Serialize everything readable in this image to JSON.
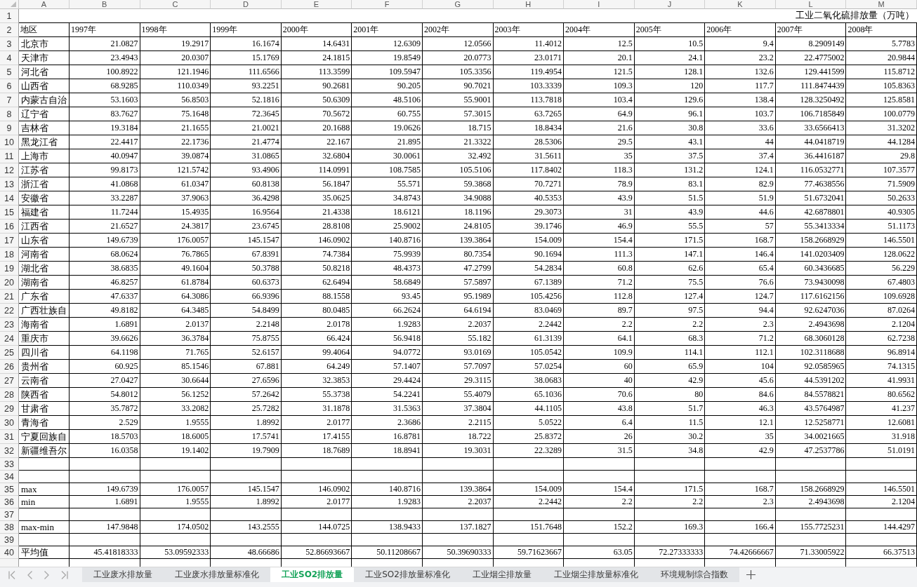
{
  "column_headers": [
    "A",
    "B",
    "C",
    "D",
    "E",
    "F",
    "G",
    "H",
    "I",
    "J",
    "K",
    "L",
    "M"
  ],
  "rows": [
    {
      "number": "1",
      "kind": "title",
      "title": "工业二氧化硫排放量（万吨）"
    },
    {
      "number": "2",
      "kind": "header",
      "cells": [
        "地区",
        "1997年",
        "1998年",
        "1999年",
        "2000年",
        "2001年",
        "2002年",
        "2003年",
        "2004年",
        "2005年",
        "2006年",
        "2007年",
        "2008年"
      ]
    },
    {
      "number": "3",
      "kind": "data",
      "cells": [
        "北京市",
        "21.0827",
        "19.2917",
        "16.1674",
        "14.6431",
        "12.6309",
        "12.0566",
        "11.4012",
        "12.5",
        "10.5",
        "9.4",
        "8.2909149",
        "5.7783"
      ]
    },
    {
      "number": "4",
      "kind": "data",
      "cells": [
        "天津市",
        "23.4943",
        "20.0307",
        "15.1769",
        "24.1815",
        "19.8549",
        "20.0773",
        "23.0171",
        "20.1",
        "24.1",
        "23.2",
        "22.4775002",
        "20.9844"
      ]
    },
    {
      "number": "5",
      "kind": "data",
      "cells": [
        "河北省",
        "100.8922",
        "121.1946",
        "111.6566",
        "113.3599",
        "109.5947",
        "105.3356",
        "119.4954",
        "121.5",
        "128.1",
        "132.6",
        "129.441599",
        "115.8712"
      ]
    },
    {
      "number": "6",
      "kind": "data",
      "cells": [
        "山西省",
        "68.9285",
        "110.0349",
        "93.2251",
        "90.2681",
        "90.205",
        "90.7021",
        "103.3339",
        "109.3",
        "120",
        "117.7",
        "111.8474439",
        "105.8363"
      ]
    },
    {
      "number": "7",
      "kind": "data",
      "cells": [
        "内蒙古自治",
        "53.1603",
        "56.8503",
        "52.1816",
        "50.6309",
        "48.5106",
        "55.9001",
        "113.7818",
        "103.4",
        "129.6",
        "138.4",
        "128.3250492",
        "125.8581"
      ]
    },
    {
      "number": "8",
      "kind": "data",
      "cells": [
        "辽宁省",
        "83.7627",
        "75.1648",
        "72.3645",
        "70.5672",
        "60.755",
        "57.3015",
        "63.7265",
        "64.9",
        "96.1",
        "103.7",
        "106.7185849",
        "100.0779"
      ]
    },
    {
      "number": "9",
      "kind": "data",
      "cells": [
        "吉林省",
        "19.3184",
        "21.1655",
        "21.0021",
        "20.1688",
        "19.0626",
        "18.715",
        "18.8434",
        "21.6",
        "30.8",
        "33.6",
        "33.6566413",
        "31.3202"
      ]
    },
    {
      "number": "10",
      "kind": "data",
      "cells": [
        "黑龙江省",
        "22.4417",
        "22.1736",
        "21.4774",
        "22.167",
        "21.895",
        "21.3322",
        "28.5306",
        "29.5",
        "43.1",
        "44",
        "44.0418719",
        "44.1284"
      ]
    },
    {
      "number": "11",
      "kind": "data",
      "cells": [
        "上海市",
        "40.0947",
        "39.0874",
        "31.0865",
        "32.6804",
        "30.0061",
        "32.492",
        "31.5611",
        "35",
        "37.5",
        "37.4",
        "36.4416187",
        "29.8"
      ]
    },
    {
      "number": "12",
      "kind": "data",
      "cells": [
        "江苏省",
        "99.8173",
        "121.5742",
        "93.4906",
        "114.0991",
        "108.7585",
        "105.5106",
        "117.8402",
        "118.3",
        "131.2",
        "124.1",
        "116.0532771",
        "107.3577"
      ]
    },
    {
      "number": "13",
      "kind": "data",
      "cells": [
        "浙江省",
        "41.0868",
        "61.0347",
        "60.8138",
        "56.1847",
        "55.571",
        "59.3868",
        "70.7271",
        "78.9",
        "83.1",
        "82.9",
        "77.4638556",
        "71.5909"
      ]
    },
    {
      "number": "14",
      "kind": "data",
      "cells": [
        "安徽省",
        "33.2287",
        "37.9063",
        "36.4298",
        "35.0625",
        "34.8743",
        "34.9088",
        "40.5353",
        "43.9",
        "51.5",
        "51.9",
        "51.6732041",
        "50.2633"
      ]
    },
    {
      "number": "15",
      "kind": "data",
      "cells": [
        "福建省",
        "11.7244",
        "15.4935",
        "16.9564",
        "21.4338",
        "18.6121",
        "18.1196",
        "29.3073",
        "31",
        "43.9",
        "44.6",
        "42.6878801",
        "40.9305"
      ]
    },
    {
      "number": "16",
      "kind": "data",
      "cells": [
        "江西省",
        "21.6527",
        "24.3817",
        "23.6745",
        "28.8108",
        "25.9002",
        "24.8105",
        "39.1746",
        "46.9",
        "55.5",
        "57",
        "55.3413334",
        "51.1173"
      ]
    },
    {
      "number": "17",
      "kind": "data",
      "cells": [
        "山东省",
        "149.6739",
        "176.0057",
        "145.1547",
        "146.0902",
        "140.8716",
        "139.3864",
        "154.009",
        "154.4",
        "171.5",
        "168.7",
        "158.2668929",
        "146.5501"
      ]
    },
    {
      "number": "18",
      "kind": "data",
      "cells": [
        "河南省",
        "68.0624",
        "76.7865",
        "67.8391",
        "74.7384",
        "75.9939",
        "80.7354",
        "90.1694",
        "111.3",
        "147.1",
        "146.4",
        "141.0203409",
        "128.0622"
      ]
    },
    {
      "number": "19",
      "kind": "data",
      "cells": [
        "湖北省",
        "38.6835",
        "49.1604",
        "50.3788",
        "50.8218",
        "48.4373",
        "47.2799",
        "54.2834",
        "60.8",
        "62.6",
        "65.4",
        "60.3436685",
        "56.229"
      ]
    },
    {
      "number": "20",
      "kind": "data",
      "cells": [
        "湖南省",
        "46.8257",
        "61.8784",
        "60.6373",
        "62.6494",
        "58.6849",
        "57.5897",
        "67.1389",
        "71.2",
        "75.5",
        "76.6",
        "73.9430098",
        "67.4803"
      ]
    },
    {
      "number": "21",
      "kind": "data",
      "cells": [
        "广东省",
        "47.6337",
        "64.3086",
        "66.9396",
        "88.1558",
        "93.45",
        "95.1989",
        "105.4256",
        "112.8",
        "127.4",
        "124.7",
        "117.6162156",
        "109.6928"
      ]
    },
    {
      "number": "22",
      "kind": "data",
      "cells": [
        "广西壮族自",
        "49.8182",
        "64.3485",
        "54.8499",
        "80.0485",
        "66.2624",
        "64.6194",
        "83.0469",
        "89.7",
        "97.5",
        "94.4",
        "92.6247036",
        "87.0264"
      ]
    },
    {
      "number": "23",
      "kind": "data",
      "cells": [
        "海南省",
        "1.6891",
        "2.0137",
        "2.2148",
        "2.0178",
        "1.9283",
        "2.2037",
        "2.2442",
        "2.2",
        "2.2",
        "2.3",
        "2.4943698",
        "2.1204"
      ]
    },
    {
      "number": "24",
      "kind": "data",
      "cells": [
        "重庆市",
        "39.6626",
        "36.3784",
        "75.8755",
        "66.424",
        "56.9418",
        "55.182",
        "61.3139",
        "64.1",
        "68.3",
        "71.2",
        "68.3060128",
        "62.7238"
      ]
    },
    {
      "number": "25",
      "kind": "data",
      "cells": [
        "四川省",
        "64.1198",
        "71.765",
        "52.6157",
        "99.4064",
        "94.0772",
        "93.0169",
        "105.0542",
        "109.9",
        "114.1",
        "112.1",
        "102.3118688",
        "96.8914"
      ]
    },
    {
      "number": "26",
      "kind": "data",
      "cells": [
        "贵州省",
        "60.925",
        "85.1546",
        "67.881",
        "64.249",
        "57.1407",
        "57.7097",
        "57.0254",
        "60",
        "65.9",
        "104",
        "92.0585965",
        "74.1315"
      ]
    },
    {
      "number": "27",
      "kind": "data",
      "cells": [
        "云南省",
        "27.0427",
        "30.6644",
        "27.6596",
        "32.3853",
        "29.4424",
        "29.3115",
        "38.0683",
        "40",
        "42.9",
        "45.6",
        "44.5391202",
        "41.9931"
      ]
    },
    {
      "number": "28",
      "kind": "data",
      "cells": [
        "陕西省",
        "54.8012",
        "56.1252",
        "57.2642",
        "55.3738",
        "54.2241",
        "55.4079",
        "65.1036",
        "70.6",
        "80",
        "84.6",
        "84.5578821",
        "80.6562"
      ]
    },
    {
      "number": "29",
      "kind": "data",
      "cells": [
        "甘肃省",
        "35.7872",
        "33.2082",
        "25.7282",
        "31.1878",
        "31.5363",
        "37.3804",
        "44.1105",
        "43.8",
        "51.7",
        "46.3",
        "43.5764987",
        "41.237"
      ]
    },
    {
      "number": "30",
      "kind": "data",
      "cells": [
        "青海省",
        "2.529",
        "1.9555",
        "1.8992",
        "2.0177",
        "2.3686",
        "2.2115",
        "5.0522",
        "6.4",
        "11.5",
        "12.1",
        "12.5258771",
        "12.6081"
      ]
    },
    {
      "number": "31",
      "kind": "data",
      "cells": [
        "宁夏回族自",
        "18.5703",
        "18.6005",
        "17.5741",
        "17.4155",
        "16.8781",
        "18.722",
        "25.8372",
        "26",
        "30.2",
        "35",
        "34.0021665",
        "31.918"
      ]
    },
    {
      "number": "32",
      "kind": "data",
      "cells": [
        "新疆维吾尔",
        "16.0358",
        "19.1402",
        "19.7909",
        "18.7689",
        "18.8941",
        "19.3031",
        "22.3289",
        "31.5",
        "34.8",
        "42.9",
        "47.2537786",
        "51.0191"
      ]
    },
    {
      "number": "33",
      "kind": "blank"
    },
    {
      "number": "34",
      "kind": "blank"
    },
    {
      "number": "35",
      "kind": "data",
      "cells": [
        "max",
        "149.6739",
        "176.0057",
        "145.1547",
        "146.0902",
        "140.8716",
        "139.3864",
        "154.009",
        "154.4",
        "171.5",
        "168.7",
        "158.2668929",
        "146.5501"
      ]
    },
    {
      "number": "36",
      "kind": "data",
      "cells": [
        "min",
        "1.6891",
        "1.9555",
        "1.8992",
        "2.0177",
        "1.9283",
        "2.2037",
        "2.2442",
        "2.2",
        "2.2",
        "2.3",
        "2.4943698",
        "2.1204"
      ]
    },
    {
      "number": "37",
      "kind": "blank"
    },
    {
      "number": "38",
      "kind": "data",
      "cells": [
        "max-min",
        "147.9848",
        "174.0502",
        "143.2555",
        "144.0725",
        "138.9433",
        "137.1827",
        "151.7648",
        "152.2",
        "169.3",
        "166.4",
        "155.7725231",
        "144.4297"
      ]
    },
    {
      "number": "39",
      "kind": "blank"
    },
    {
      "number": "40",
      "kind": "data",
      "cells": [
        "平均值",
        "45.41818333",
        "53.09592333",
        "48.66686",
        "52.86693667",
        "50.11208667",
        "50.39690333",
        "59.71623667",
        "63.05",
        "72.27333333",
        "74.42666667",
        "71.33005922",
        "66.37513"
      ]
    }
  ],
  "sheet_tabs": [
    {
      "label": "工业废水排放量",
      "selected": false
    },
    {
      "label": "工业废水排放量标准化",
      "selected": false
    },
    {
      "label": "工业SO2排放量",
      "selected": true
    },
    {
      "label": "工业SO2排放量标准化",
      "selected": false
    },
    {
      "label": "工业烟尘排放量",
      "selected": false
    },
    {
      "label": "工业烟尘排放量标准化",
      "selected": false
    },
    {
      "label": "环境规制综合指数",
      "selected": false
    }
  ]
}
